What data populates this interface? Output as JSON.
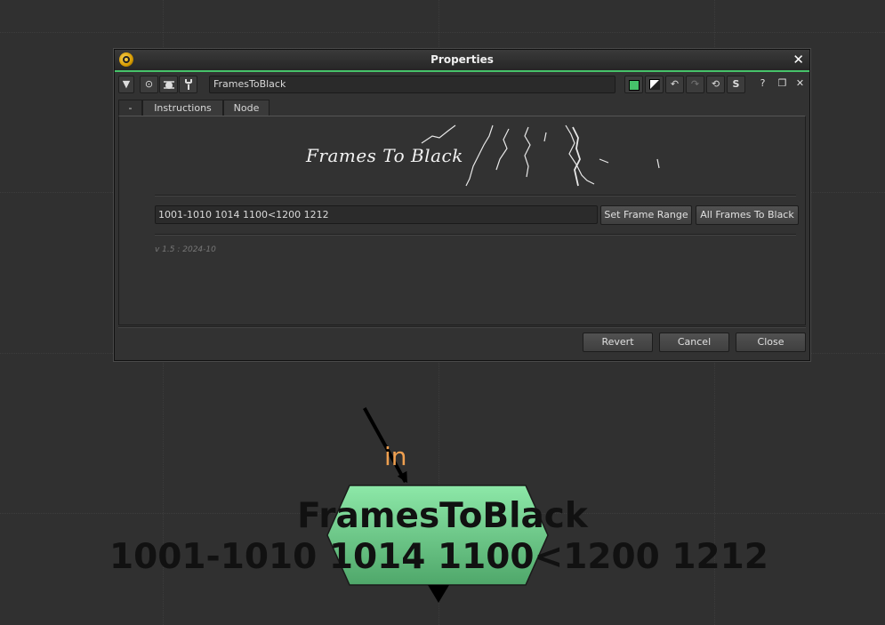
{
  "window": {
    "title": "Properties",
    "close_glyph": "✕"
  },
  "toolbar": {
    "node_name": "FramesToBlack",
    "icons": [
      "collapse-icon",
      "viewer-icon",
      "bug-icon",
      "wrench-icon",
      "color-swatch-icon",
      "mask-icon",
      "undo-icon",
      "redo-icon",
      "revert-icon",
      "script-icon",
      "help-icon",
      "float-icon",
      "close-icon"
    ]
  },
  "tabs": [
    {
      "label": "-"
    },
    {
      "label": "Instructions"
    },
    {
      "label": "Node"
    }
  ],
  "panel": {
    "logo_text": "Frames To Black",
    "frame_range": "1001-1010 1014 1100<1200 1212",
    "set_range_label": "Set Frame Range",
    "all_frames_label": "All Frames To Black",
    "version": "v 1.5 : 2024-10"
  },
  "footer": {
    "revert": "Revert",
    "cancel": "Cancel",
    "close": "Close"
  },
  "node": {
    "input_label": "in",
    "title": "FramesToBlack",
    "subtitle": "1001-1010 1014 1100<1200 1212",
    "fill_color": "#6ccf8e",
    "accent": "#46c36a"
  }
}
